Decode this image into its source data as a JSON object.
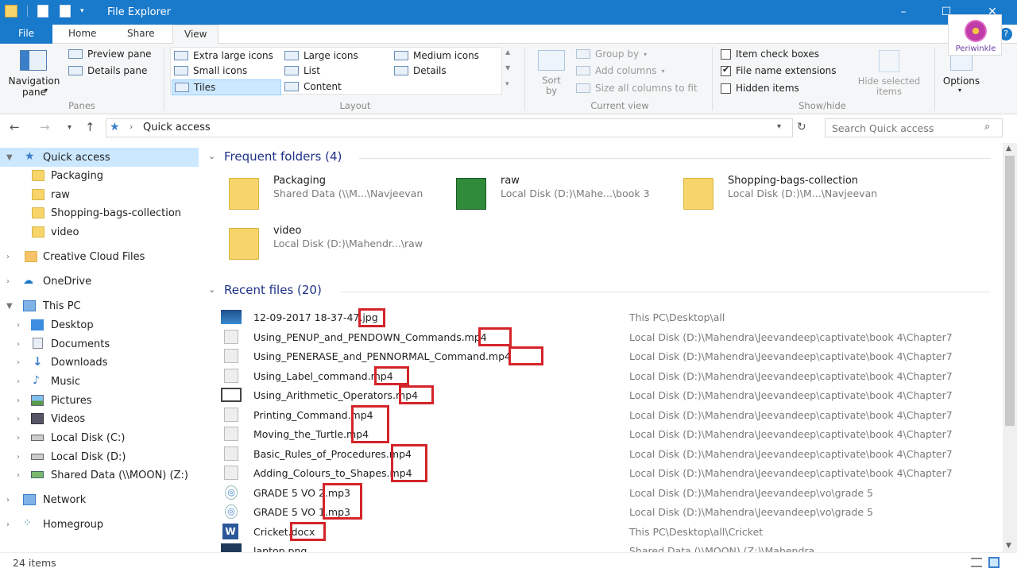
{
  "window": {
    "title": "File Explorer",
    "controls": {
      "minimize": "–",
      "maximize": "☐",
      "close": "✕"
    }
  },
  "ribbon_tabs": [
    "File",
    "Home",
    "Share",
    "View"
  ],
  "ribbon": {
    "panes": {
      "navigation_pane": "Navigation pane",
      "preview_pane": "Preview pane",
      "details_pane": "Details pane",
      "group": "Panes"
    },
    "layout": {
      "items": [
        "Extra large icons",
        "Large icons",
        "Medium icons",
        "Small icons",
        "List",
        "Details",
        "Tiles",
        "Content"
      ],
      "selected": "Tiles",
      "group": "Layout"
    },
    "current_view": {
      "sort_by": "Sort by",
      "group_by": "Group by",
      "add_columns": "Add columns",
      "size_all_columns": "Size all columns to fit",
      "group": "Current view"
    },
    "show_hide": {
      "item_check_boxes": "Item check boxes",
      "file_name_extensions": "File name extensions",
      "hidden_items": "Hidden items",
      "hide_selected_items": "Hide selected items",
      "options": "Options",
      "group": "Show/hide",
      "states": {
        "item_check_boxes": false,
        "file_name_extensions": true,
        "hidden_items": false
      }
    }
  },
  "address": {
    "path": "Quick access",
    "search_placeholder": "Search Quick access"
  },
  "sidebar": {
    "quick_access": "Quick access",
    "pinned": [
      "Packaging",
      "raw",
      "Shopping-bags-collection",
      "video"
    ],
    "creative_cloud": "Creative Cloud Files",
    "onedrive": "OneDrive",
    "this_pc": "This PC",
    "pc_items": [
      "Desktop",
      "Documents",
      "Downloads",
      "Music",
      "Pictures",
      "Videos",
      "Local Disk (C:)",
      "Local Disk (D:)",
      "Shared Data (\\\\MOON) (Z:)"
    ],
    "network": "Network",
    "homegroup": "Homegroup"
  },
  "frequent_folders": {
    "heading": "Frequent folders (4)",
    "items": [
      {
        "name": "Packaging",
        "path": "Shared Data (\\\\M...\\Navjeevan"
      },
      {
        "name": "raw",
        "path": "Local Disk (D:)\\Mahe...\\book 3"
      },
      {
        "name": "Shopping-bags-collection",
        "path": "Local Disk (D:)\\M...\\Navjeevan"
      },
      {
        "name": "video",
        "path": "Local Disk (D:)\\Mahendr...\\raw"
      }
    ]
  },
  "recent_files": {
    "heading": "Recent files (20)",
    "items": [
      {
        "name": "12-09-2017 18-37-47.jpg",
        "path": "This PC\\Desktop\\all"
      },
      {
        "name": "Using_PENUP_and_PENDOWN_Commands.mp4",
        "path": "Local Disk (D:)\\Mahendra\\Jeevandeep\\captivate\\book 4\\Chapter7"
      },
      {
        "name": "Using_PENERASE_and_PENNORMAL_Command.mp4",
        "path": "Local Disk (D:)\\Mahendra\\Jeevandeep\\captivate\\book 4\\Chapter7"
      },
      {
        "name": "Using_Label_command.mp4",
        "path": "Local Disk (D:)\\Mahendra\\Jeevandeep\\captivate\\book 4\\Chapter7"
      },
      {
        "name": "Using_Arithmetic_Operators.mp4",
        "path": "Local Disk (D:)\\Mahendra\\Jeevandeep\\captivate\\book 4\\Chapter7"
      },
      {
        "name": "Printing_Command.mp4",
        "path": "Local Disk (D:)\\Mahendra\\Jeevandeep\\captivate\\book 4\\Chapter7"
      },
      {
        "name": "Moving_the_Turtle.mp4",
        "path": "Local Disk (D:)\\Mahendra\\Jeevandeep\\captivate\\book 4\\Chapter7"
      },
      {
        "name": "Basic_Rules_of_Procedures.mp4",
        "path": "Local Disk (D:)\\Mahendra\\Jeevandeep\\captivate\\book 4\\Chapter7"
      },
      {
        "name": "Adding_Colours_to_Shapes.mp4",
        "path": "Local Disk (D:)\\Mahendra\\Jeevandeep\\captivate\\book 4\\Chapter7"
      },
      {
        "name": "GRADE 5 VO 2.mp3",
        "path": "Local Disk (D:)\\Mahendra\\Jeevandeep\\vo\\grade 5"
      },
      {
        "name": "GRADE 5 VO 1.mp3",
        "path": "Local Disk (D:)\\Mahendra\\Jeevandeep\\vo\\grade 5"
      },
      {
        "name": "Cricket.docx",
        "path": "This PC\\Desktop\\all\\Cricket"
      },
      {
        "name": "laptop.png",
        "path": "Shared Data (\\\\MOON) (Z:)\\Mahendra"
      }
    ]
  },
  "status": {
    "items_count": "24 items"
  },
  "badge": {
    "label": "Periwinkle"
  },
  "colors": {
    "accent": "#1979ca",
    "highlight": "#d4242a",
    "section": "#1e3287",
    "selection": "#cce8ff"
  }
}
